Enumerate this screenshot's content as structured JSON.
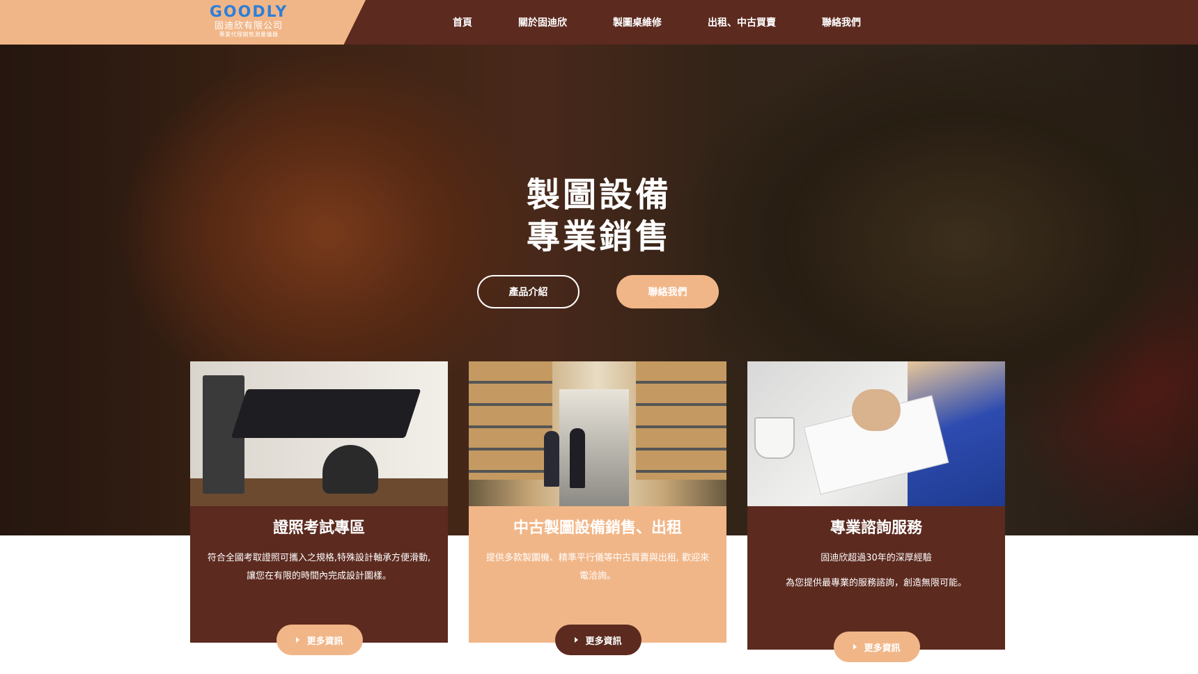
{
  "logo": {
    "en": "GOODLY",
    "zh": "固迪欣有限公司",
    "sub": "專業代理銷售測量儀器"
  },
  "nav": [
    {
      "label": "首頁"
    },
    {
      "label": "關於固迪欣"
    },
    {
      "label": "製圖桌維修"
    },
    {
      "label": "出租、中古買賣"
    },
    {
      "label": "聯絡我們"
    }
  ],
  "hero": {
    "title_line1": "製圖設備",
    "title_line2": "專業銷售",
    "btn_products": "產品介紹",
    "btn_contact": "聯絡我們"
  },
  "cards": [
    {
      "title": "證照考試專區",
      "text1": "符合全國考取證照可攜入之規格,特殊設計軸承方便滑動, 讓您在有限的時間內完成設計圖樣。",
      "text2": "",
      "button": "更多資訊"
    },
    {
      "title": "中古製圖設備銷售、出租",
      "text1": "提供多款製圖機、精準平行儀等中古買賣與出租, 歡迎來電洽詢。",
      "text2": "",
      "button": "更多資訊"
    },
    {
      "title": "專業諮詢服務",
      "text1": "固迪欣超過30年的深厚經驗",
      "text2": "為您提供最專業的服務諮詢，創造無限可能。",
      "button": "更多資訊"
    }
  ],
  "colors": {
    "brown": "#5c2a1f",
    "peach": "#f1b688",
    "logo_blue": "#2e7fd8"
  }
}
